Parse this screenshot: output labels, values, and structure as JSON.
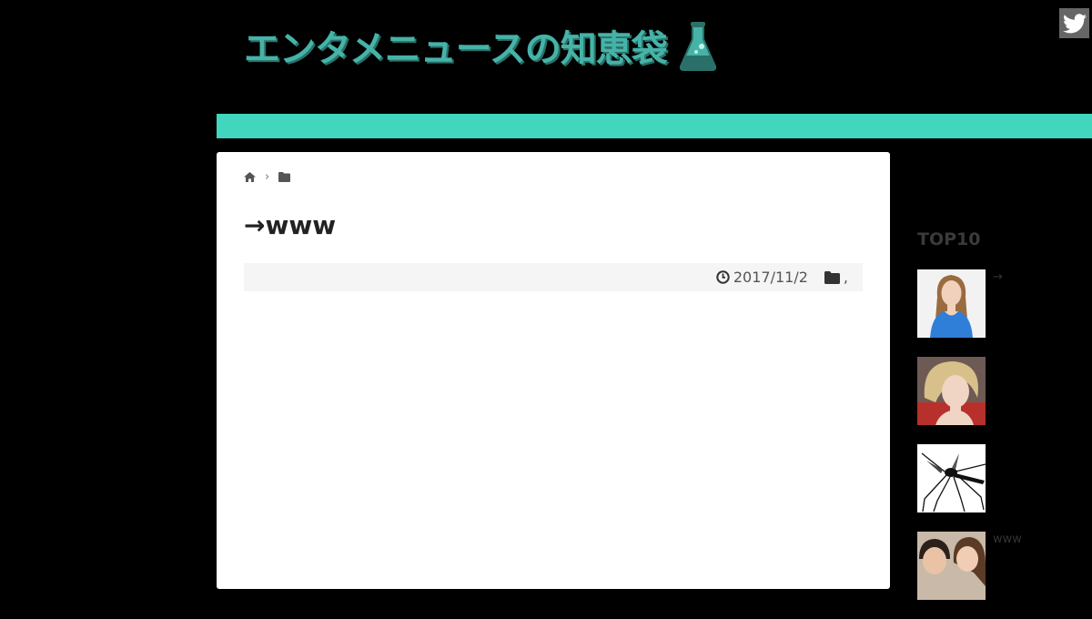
{
  "header": {
    "site_title": "エンタメニュースの知恵袋",
    "logo_icon": "flask-icon",
    "twitter_icon": "twitter-icon"
  },
  "colors": {
    "accent": "#41d6bd",
    "logo_text": "#45b3a8",
    "background": "#000000",
    "card": "#ffffff"
  },
  "breadcrumb": {
    "home_icon": "home-icon",
    "separator": "›",
    "folder_icon": "folder-icon"
  },
  "post": {
    "title": "→www",
    "date_icon": "clock-icon",
    "date": "2017/11/2",
    "category_icon": "folder-icon",
    "categories": ","
  },
  "sidebar": {
    "title": "TOP10",
    "items": [
      {
        "text": "→",
        "thumb": "woman-blue-top-thumbnail"
      },
      {
        "text": "",
        "thumb": "blonde-woman-thumbnail"
      },
      {
        "text": "",
        "thumb": "mosquito-thumbnail"
      },
      {
        "text": "www",
        "thumb": "couple-thumbnail"
      }
    ]
  }
}
